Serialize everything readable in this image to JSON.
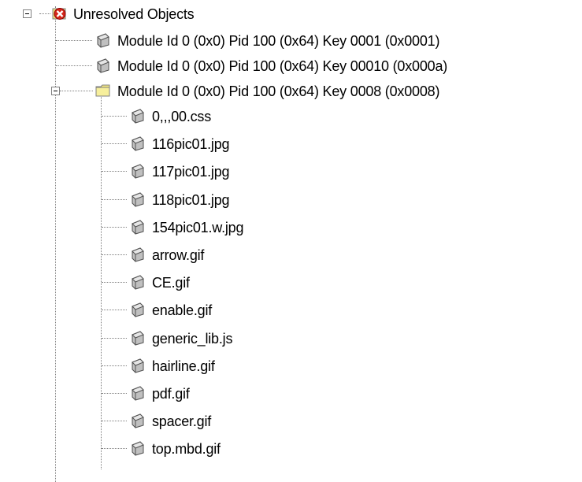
{
  "tree": {
    "root": {
      "label": "Unresolved Objects",
      "icon": "unresolved-error-icon",
      "expanded": true
    },
    "modules": [
      {
        "label": "Module Id 0 (0x0) Pid 100 (0x64) Key 0001 (0x0001)",
        "icon": "document-icon"
      },
      {
        "label": "Module Id 0 (0x0) Pid 100 (0x64) Key 00010 (0x000a)",
        "icon": "document-icon"
      },
      {
        "label": "Module Id 0 (0x0) Pid 100 (0x64) Key 0008 (0x0008)",
        "icon": "folder-icon",
        "expanded": true
      }
    ],
    "files": [
      "0,,,00.css",
      "116pic01.jpg",
      "117pic01.jpg",
      "118pic01.jpg",
      "154pic01.w.jpg",
      "arrow.gif",
      "CE.gif",
      "enable.gif",
      "generic_lib.js",
      "hairline.gif",
      "pdf.gif",
      "spacer.gif",
      "top.mbd.gif"
    ]
  },
  "colors": {
    "tree_line": "#808080",
    "error_icon": "#d4271a",
    "folder": "#f2e680",
    "document": "#c0c0c0"
  }
}
